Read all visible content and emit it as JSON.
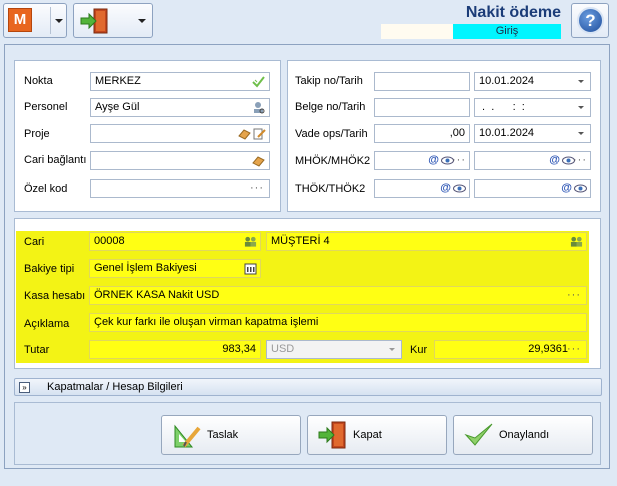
{
  "toolbar": {
    "logo_letter": "M",
    "title": "Nakit ödeme",
    "status": "Giriş",
    "help_symbol": "?"
  },
  "left_form": {
    "nokta": {
      "label": "Nokta",
      "value": "MERKEZ"
    },
    "personel": {
      "label": "Personel",
      "value": "Ayşe Gül"
    },
    "proje": {
      "label": "Proje",
      "value": ""
    },
    "cari_baglanti": {
      "label": "Cari bağlantı",
      "value": ""
    },
    "ozel_kod": {
      "label": "Özel kod",
      "value": ""
    }
  },
  "right_form": {
    "takip": {
      "label": "Takip no/Tarih",
      "value": "",
      "date": "10.01.2024"
    },
    "belge": {
      "label": "Belge no/Tarih",
      "value": "",
      "date": " .  .      :  :"
    },
    "vade": {
      "label": "Vade ops/Tarih",
      "value": ",00",
      "date": "10.01.2024"
    },
    "mhok": {
      "label": "MHÖK/MHÖK2",
      "value": "",
      "value2": ""
    },
    "thok": {
      "label": "THÖK/THÖK2",
      "value": "",
      "value2": ""
    }
  },
  "details": {
    "cari": {
      "label": "Cari",
      "code": "00008",
      "name": "MÜŞTERİ 4"
    },
    "bakiye_tipi": {
      "label": "Bakiye tipi",
      "value": "Genel İşlem Bakiyesi"
    },
    "kasa_hesabi": {
      "label": "Kasa hesabı",
      "value": "ÖRNEK KASA Nakit USD"
    },
    "aciklama": {
      "label": "Açıklama",
      "value": "Çek kur farkı ile oluşan virman kapatma işlemi"
    },
    "tutar": {
      "label": "Tutar",
      "value": "983,34",
      "currency": "USD"
    },
    "kur": {
      "label": "Kur",
      "value": "29,9361"
    }
  },
  "expander": {
    "label": "Kapatmalar / Hesap Bilgileri"
  },
  "buttons": {
    "taslak": "Taslak",
    "kapat": "Kapat",
    "onaylandi": "Onaylandı"
  },
  "colors": {
    "highlight": "#ffff14",
    "status_bar": "#00f5ff",
    "title": "#1b3c78",
    "accent": "#e8661f"
  }
}
